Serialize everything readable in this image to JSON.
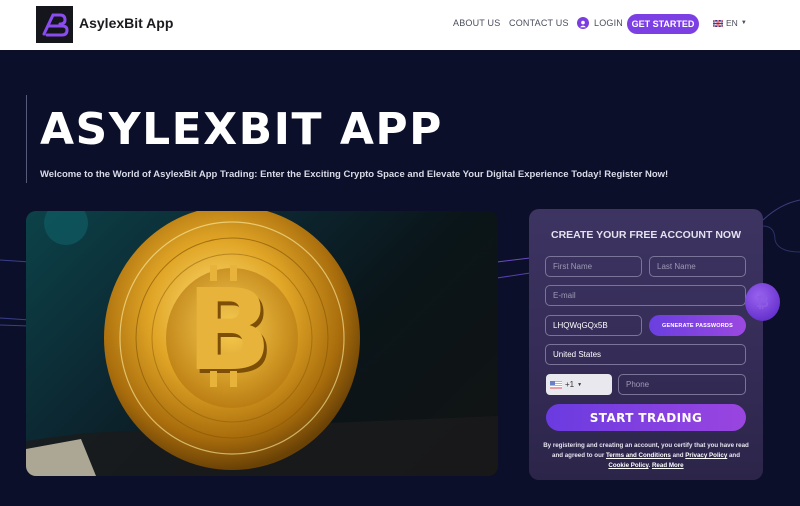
{
  "header": {
    "logo_text": "AsylexBit App",
    "logo_icon": "ab-monogram-icon",
    "nav": {
      "about": "ABOUT US",
      "contact": "CONTACT US",
      "login": "LOGIN",
      "get_started": "GET STARTED",
      "language": "EN"
    },
    "brand_color": "#7b3fe4"
  },
  "hero": {
    "title": "ASYLEXBIT APP",
    "subtitle": "Welcome to the World of AsylexBit App Trading: Enter the Exciting Crypto Space and Elevate Your Digital Experience Today! Register Now!",
    "image": "bitcoin-coin-photo"
  },
  "form": {
    "title": "CREATE YOUR FREE ACCOUNT NOW",
    "first_name_placeholder": "First Name",
    "last_name_placeholder": "Last Name",
    "email_placeholder": "E-mail",
    "password_value": "LHQWqGQx5B",
    "generate_label": "GENERATE PASSWORDS",
    "country_value": "United States",
    "phone_code": "+1",
    "phone_placeholder": "Phone",
    "submit_label": "START TRADING",
    "disclaimer": {
      "text1": "By registering and creating an account, you certify that you have read and agreed to our ",
      "terms": "Terms and Conditions",
      "and1": " and ",
      "privacy": "Privacy Policy",
      "and2": " and ",
      "cookie": "Cookie Policy",
      "sep": ". ",
      "read_more": "Read More"
    }
  }
}
